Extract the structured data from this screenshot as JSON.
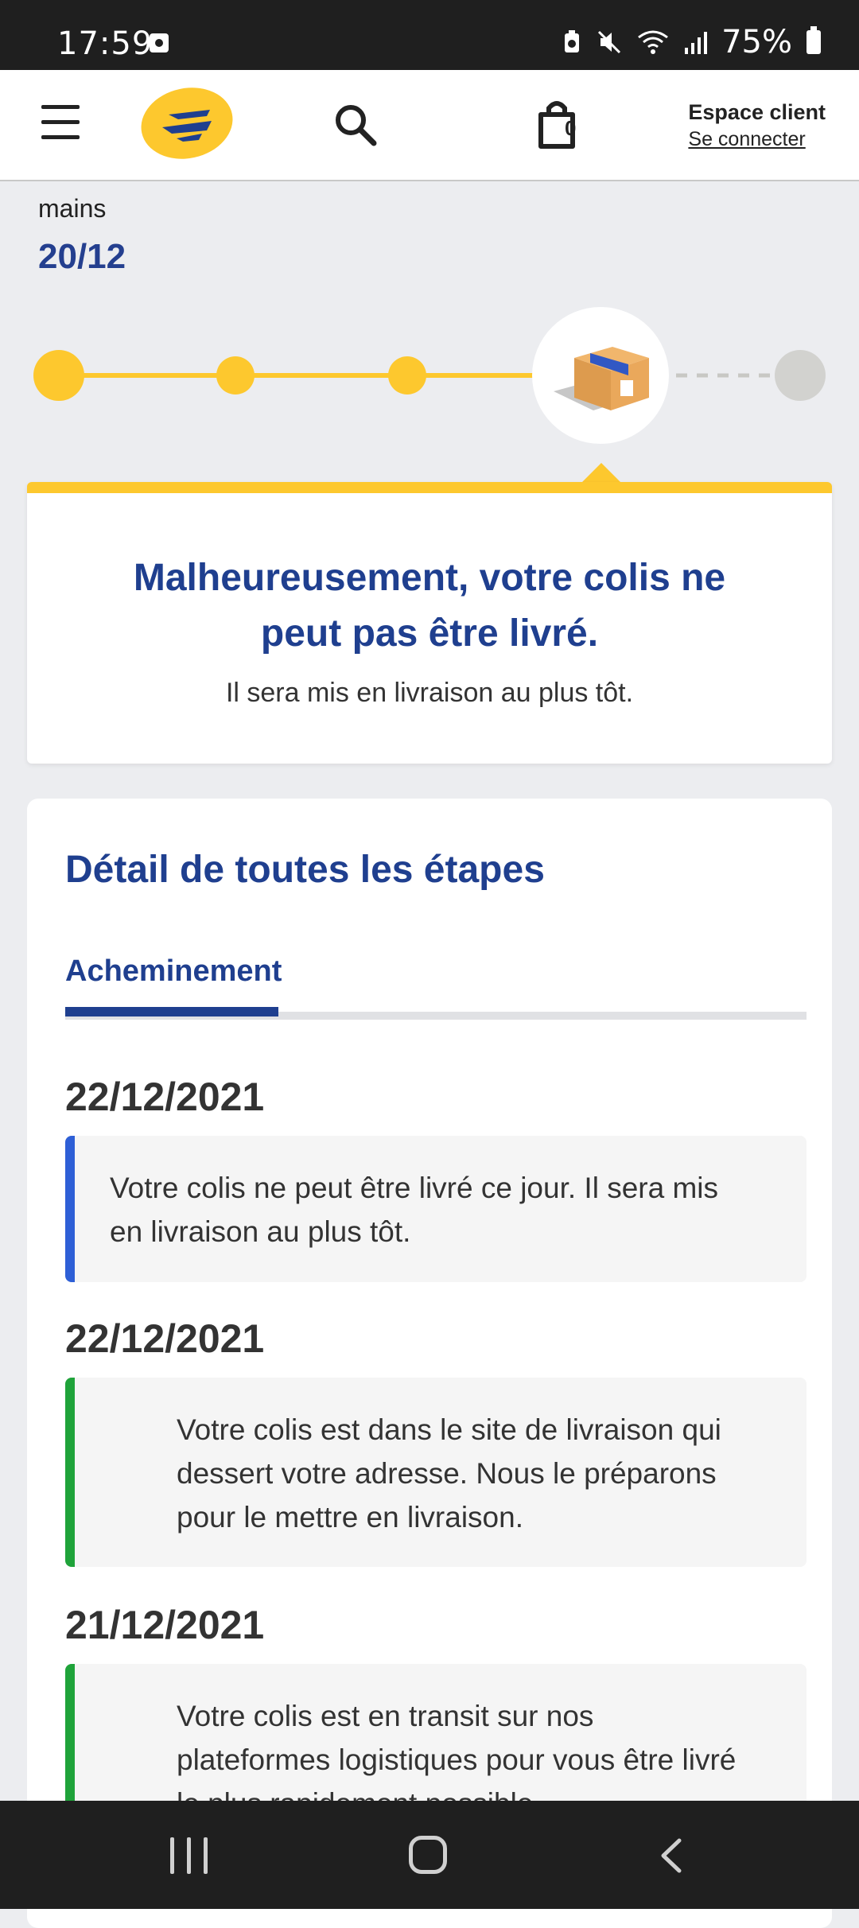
{
  "status_bar": {
    "time": "17:59",
    "battery": "75%"
  },
  "header": {
    "bag_count": "0",
    "account_title": "Espace client",
    "account_link": "Se connecter"
  },
  "summary": {
    "label": "mains",
    "date": "20/12"
  },
  "progress_tracker": {
    "completed_steps": 3,
    "current_step": 4,
    "total_steps": 5,
    "accent_color": "#fdc82e"
  },
  "alert_card": {
    "title": "Malheureusement, votre colis ne peut pas être livré.",
    "subtitle": "Il sera mis en livraison au plus tôt."
  },
  "details": {
    "title": "Détail de toutes les étapes",
    "tab_label": "Acheminement",
    "events": [
      {
        "date": "22/12/2021",
        "text": "Votre colis ne peut être livré ce jour. Il sera mis en livraison au plus tôt.",
        "color": "#2e5fd6"
      },
      {
        "date": "22/12/2021",
        "text": "Votre colis est dans le site de livraison qui dessert votre adresse. Nous le préparons pour le mettre en livraison.",
        "color": "#1fa33a"
      },
      {
        "date": "21/12/2021",
        "text": "Votre colis est en transit sur nos plateformes logistiques pour vous être livré le plus rapidement possible.",
        "color": "#1fa33a"
      }
    ]
  }
}
